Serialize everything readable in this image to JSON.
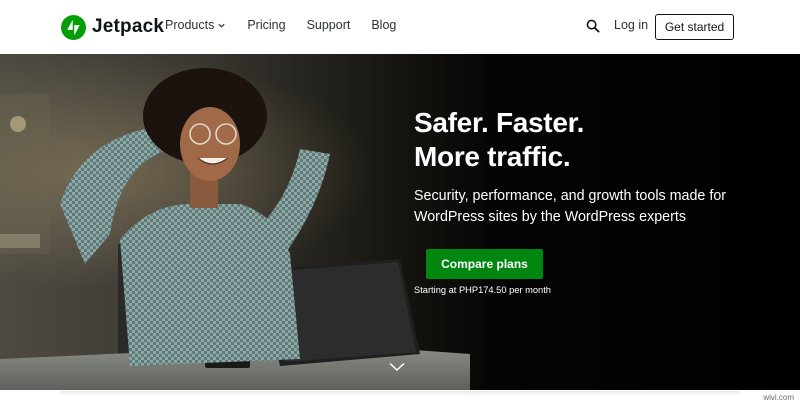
{
  "brand": {
    "name": "Jetpack",
    "color": "#069e08"
  },
  "nav": {
    "links": [
      "Products",
      "Pricing",
      "Support",
      "Blog"
    ],
    "login": "Log in",
    "cta": "Get started"
  },
  "hero": {
    "headline_line1": "Safer. Faster.",
    "headline_line2": "More traffic.",
    "subtext": "Security, performance, and growth tools made for WordPress sites by the WordPress experts",
    "button": "Compare plans",
    "price_note": "Starting at PHP174.50 per month",
    "button_color": "#008710"
  },
  "watermark": "wivi.com",
  "icons": [
    "jetpack-logo-icon",
    "chevron-down-icon",
    "search-icon",
    "scroll-down-chevron-icon"
  ]
}
